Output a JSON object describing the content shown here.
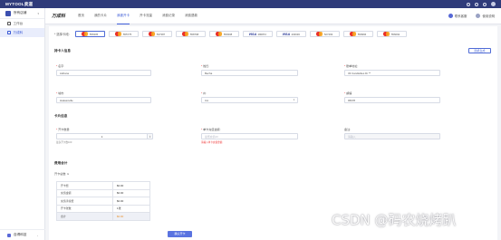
{
  "app": {
    "logo": "MYTOOL卖道",
    "brand": "万成科"
  },
  "sidebar": {
    "project": "所有店铺",
    "items": [
      {
        "label": "工作台"
      },
      {
        "label": "万成科"
      }
    ],
    "footer": "自得科技"
  },
  "tabs": [
    {
      "label": "首页"
    },
    {
      "label": "我的卡片"
    },
    {
      "label": "我被开卡"
    },
    {
      "label": "开卡流量"
    },
    {
      "label": "消费记录"
    },
    {
      "label": "消费退款"
    }
  ],
  "tab_right": [
    {
      "label": "联系客服"
    },
    {
      "label": "使用说明"
    }
  ],
  "cards": {
    "label": "* 选择卡段:",
    "items": [
      {
        "brand": "mastercard",
        "number": "556305"
      },
      {
        "brand": "mastercard",
        "number": "555775"
      },
      {
        "brand": "mastercard",
        "number": "537387"
      },
      {
        "brand": "mastercard",
        "number": "558768"
      },
      {
        "brand": "mastercard",
        "number": "559308"
      },
      {
        "brand": "visa",
        "brand_text": "VISA",
        "number": "480872"
      },
      {
        "brand": "visa",
        "brand_text": "VISA",
        "number": "403636"
      },
      {
        "brand": "mastercard",
        "number": "527493"
      },
      {
        "brand": "mastercard",
        "number": "559966"
      },
      {
        "brand": "mastercard",
        "number": "556092"
      }
    ]
  },
  "holder": {
    "title": "持卡人信息",
    "fill_button": "随机生成",
    "first_name": {
      "label": "名字:",
      "value": "Adriana"
    },
    "last_name": {
      "label": "姓氏:",
      "value": "Becha"
    },
    "address": {
      "label": "账单地址:",
      "value": "33 Candlelites Dr **"
    },
    "city": {
      "label": "城市:",
      "value": "Hakassville"
    },
    "state": {
      "label": "州:",
      "value": "CA"
    },
    "zip": {
      "label": "邮编:",
      "value": "95678"
    }
  },
  "open": {
    "title": "卡片信息",
    "count": {
      "label": "开卡数量:",
      "value": "1",
      "hint": "最多开卡数100"
    },
    "topup": {
      "label": "单卡充值金额:",
      "placeholder": "最低充值20",
      "error": "请输入单卡充值金额"
    },
    "remark": {
      "label": "备注:",
      "placeholder": "请输入"
    }
  },
  "fees": {
    "title": "费用合计",
    "total_label": "开卡总数:",
    "total_value": "1",
    "rows": [
      {
        "k": "开卡费",
        "v": "$0.00"
      },
      {
        "k": "充值金额",
        "v": "$0.00"
      },
      {
        "k": "充值手续费",
        "v": "$0.00"
      },
      {
        "k": "开卡张数",
        "v": "1张"
      },
      {
        "k": "合计",
        "v": "$0.00",
        "sum": true
      }
    ]
  },
  "confirm_button": "确认开卡",
  "watermark": "CSDN @码农烧烤趴"
}
